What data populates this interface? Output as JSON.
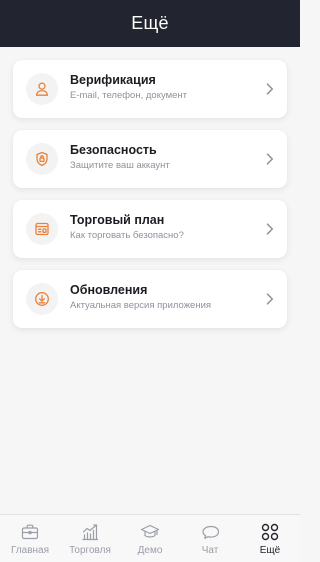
{
  "header": {
    "title": "Ещё"
  },
  "menu": [
    {
      "title": "Верификация",
      "subtitle": "E-mail, телефон, документ",
      "icon": "user-icon"
    },
    {
      "title": "Безопасность",
      "subtitle": "Защитите ваш аккаунт",
      "icon": "shield-icon"
    },
    {
      "title": "Торговый план",
      "subtitle": "Как торговать безопасно?",
      "icon": "trading-plan-icon"
    },
    {
      "title": "Обновления",
      "subtitle": "Актуальная версия приложения",
      "icon": "download-icon"
    }
  ],
  "tabbar": [
    {
      "label": "Главная",
      "icon": "briefcase-icon"
    },
    {
      "label": "Торговля",
      "icon": "chart-icon"
    },
    {
      "label": "Демо",
      "icon": "graduation-cap-icon"
    },
    {
      "label": "Чат",
      "icon": "chat-icon"
    },
    {
      "label": "Ещё",
      "icon": "grid-icon",
      "active": true
    }
  ],
  "colors": {
    "accent": "#e8823a",
    "header_bg": "#222530",
    "muted": "#9a9ea6"
  }
}
